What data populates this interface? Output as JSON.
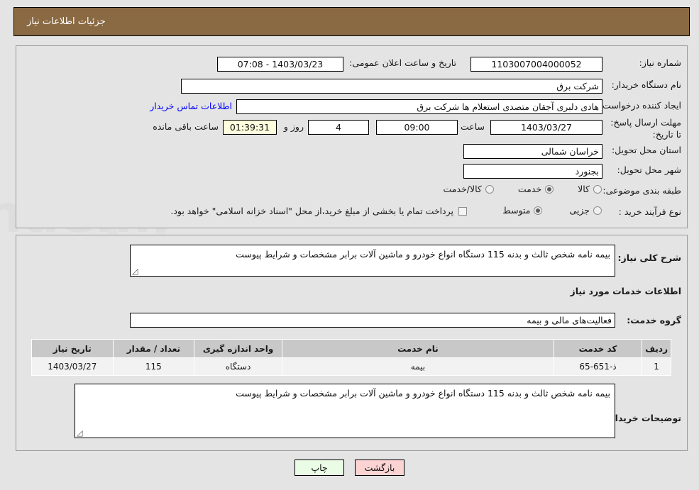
{
  "header": {
    "title": "جزئیات اطلاعات نیاز",
    "bg": "#8a6a43",
    "fg": "#ffffff"
  },
  "watermark": {
    "text": "AriaTender.ir"
  },
  "top_section": {
    "need_number": {
      "label": "شماره نیاز:",
      "value": "1103007004000052"
    },
    "public_announce": {
      "label": "تاریخ و ساعت اعلان عمومی:",
      "value": "1403/03/23 - 07:08"
    },
    "buyer_org": {
      "label": "نام دستگاه خریدار:",
      "value": "شرکت برق"
    },
    "requester": {
      "label": "ایجاد کننده درخواست:",
      "value": "هادی دلبری آجقان متصدی استعلام ها  شرکت برق"
    },
    "contact_link": {
      "label": "اطلاعات تماس خریدار",
      "color": "#0000ff"
    },
    "deadline": {
      "label": "مهلت ارسال پاسخ: تا تاریخ:",
      "date": "1403/03/27",
      "hour_label": "ساعت",
      "hour": "09:00",
      "days": "4",
      "days_label": "روز و",
      "timer": "01:39:31",
      "timer_suffix": "ساعت باقی مانده",
      "timer_bg": "#ffffdf"
    },
    "province": {
      "label": "استان محل تحویل:",
      "value": "خراسان شمالی"
    },
    "city": {
      "label": "شهر محل تحویل:",
      "value": "بجنورد"
    },
    "category": {
      "label": "طبقه بندی موضوعی:",
      "options": [
        {
          "label": "کالا",
          "selected": false
        },
        {
          "label": "خدمت",
          "selected": true
        },
        {
          "label": "کالا/خدمت",
          "selected": false
        }
      ]
    },
    "purchase_type": {
      "label": "نوع فرآیند خرید :",
      "options": [
        {
          "label": "جزیی",
          "selected": false
        },
        {
          "label": "متوسط",
          "selected": true
        }
      ],
      "checkbox": {
        "checked": false,
        "text": "پرداخت تمام یا بخشی از مبلغ خرید،از محل \"اسناد خزانه اسلامی\" خواهد بود."
      }
    }
  },
  "mid_section": {
    "general_desc": {
      "label": "شرح کلی نیاز:",
      "value": "بیمه نامه شخص ثالث  و بدنه 115 دستگاه انواع خودرو و ماشین آلات برابر مشخصات و شرایط پیوست"
    },
    "services_heading": "اطلاعات خدمات مورد نیاز",
    "service_group": {
      "label": "گروه خدمت:",
      "value": "فعالیت‌های مالی و بیمه"
    },
    "table": {
      "columns": [
        "ردیف",
        "کد خدمت",
        "نام خدمت",
        "واحد اندازه گیری",
        "تعداد / مقدار",
        "تاریخ نیاز"
      ],
      "rows": [
        [
          "1",
          "ذ-651-65",
          "بیمه",
          "دستگاه",
          "115",
          "1403/03/27"
        ]
      ]
    },
    "buyer_notes": {
      "label": "توضیحات خریدار:",
      "value": "بیمه نامه شخص ثالث  و بدنه 115 دستگاه انواع خودرو و ماشین آلات برابر مشخصات و شرایط پیوست"
    }
  },
  "footer": {
    "print_button": "چاپ",
    "back_button": "بازگشت"
  }
}
